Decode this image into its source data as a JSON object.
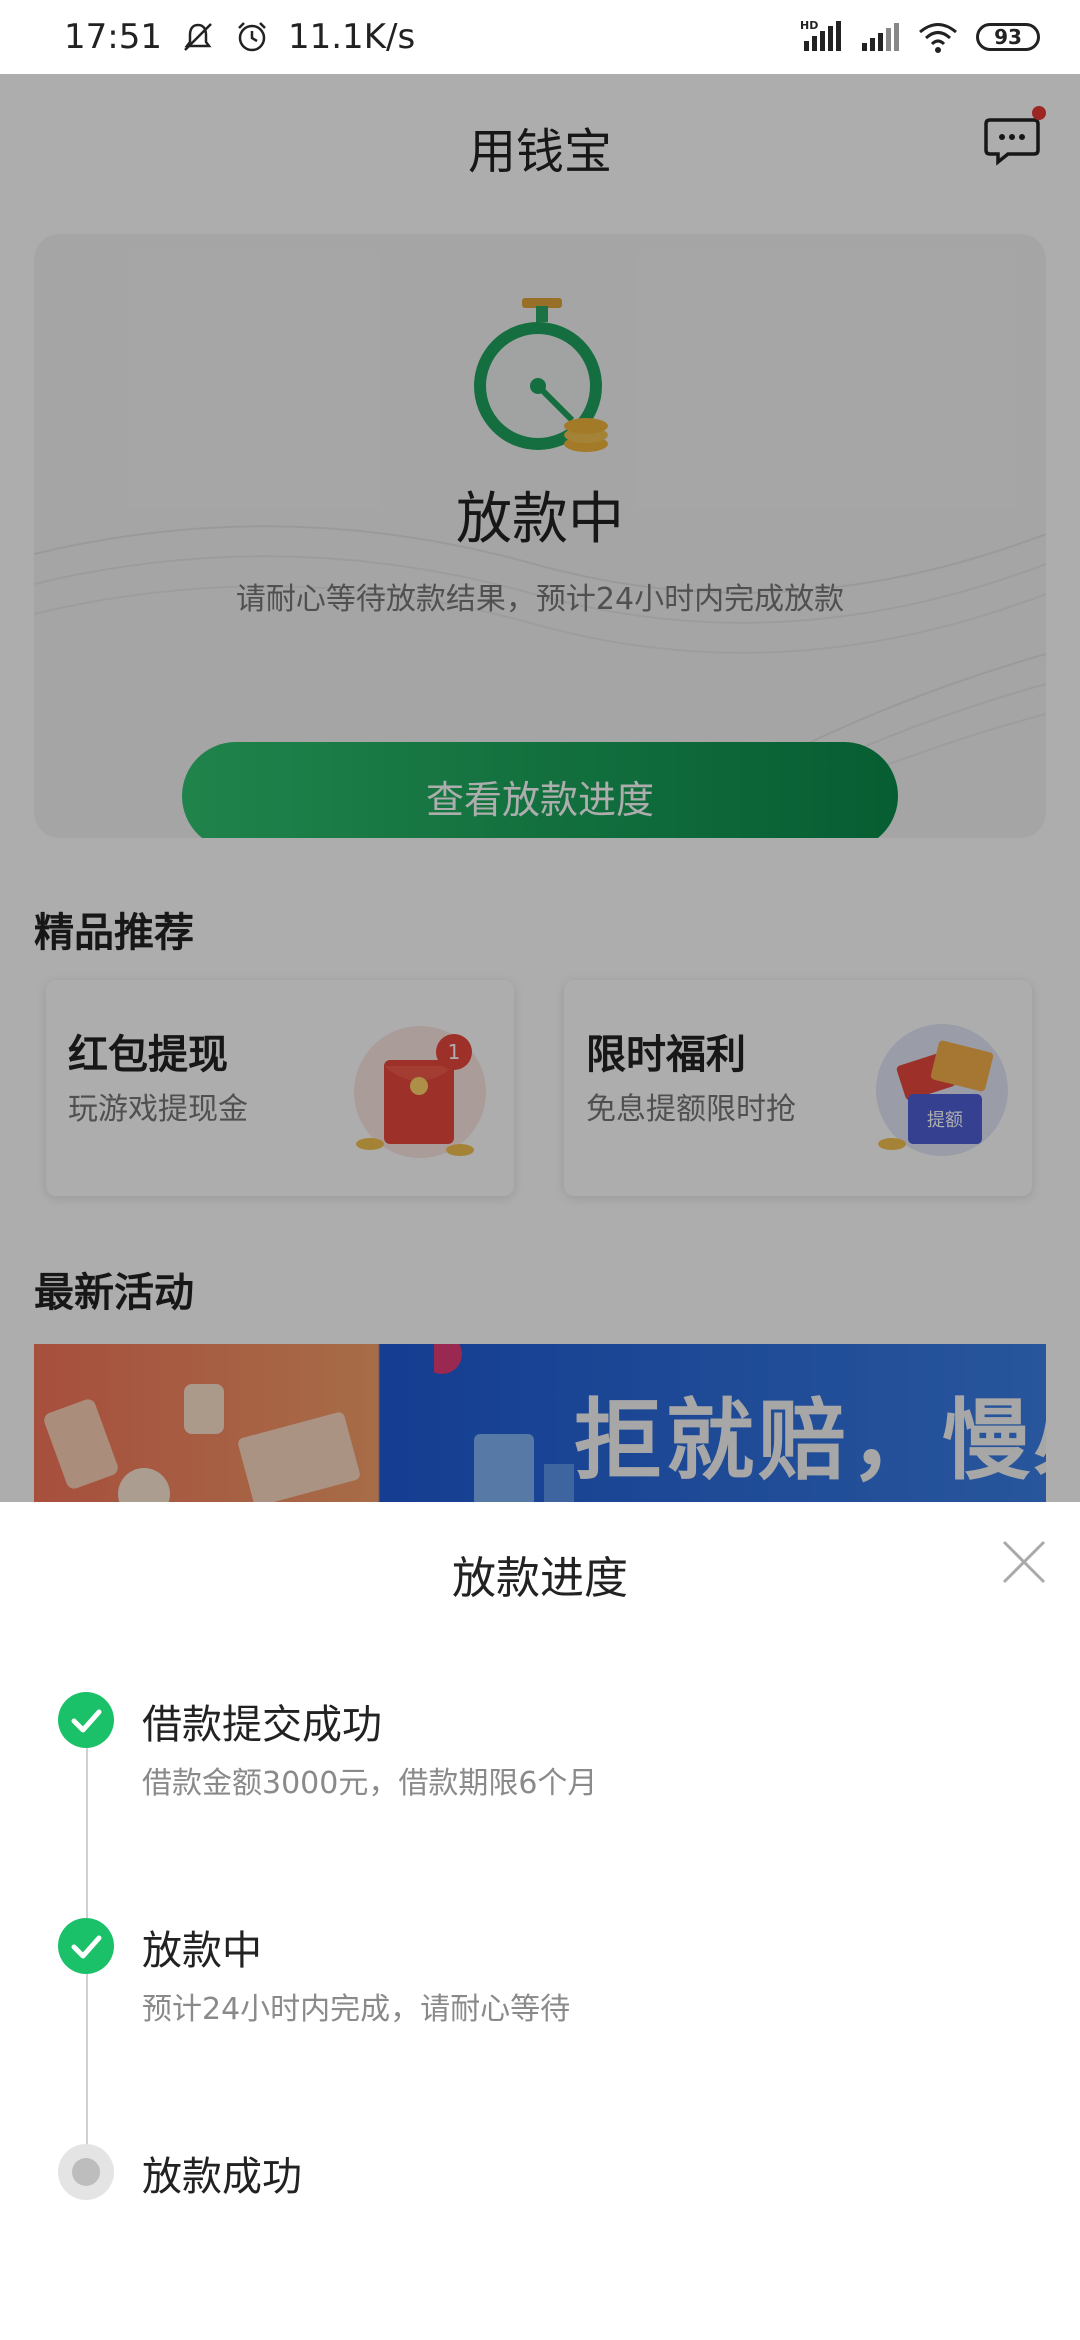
{
  "status_bar": {
    "time": "17:51",
    "net_speed": "11.1K/s",
    "battery": "93",
    "hd_label": "HD"
  },
  "header": {
    "title": "用钱宝"
  },
  "status_card": {
    "title": "放款中",
    "subtitle": "请耐心等待放款结果，预计24小时内完成放款",
    "button": "查看放款进度"
  },
  "recommend": {
    "title": "精品推荐",
    "cards": [
      {
        "title": "红包提现",
        "subtitle": "玩游戏提现金",
        "badge": "1"
      },
      {
        "title": "限时福利",
        "subtitle": "免息提额限时抢",
        "badge_text": "提额"
      }
    ]
  },
  "activities": {
    "title": "最新活动",
    "banner_text": "拒就赔，慢必"
  },
  "sheet": {
    "title": "放款进度",
    "steps": [
      {
        "title": "借款提交成功",
        "subtitle": "借款金额3000元，借款期限6个月",
        "state": "done"
      },
      {
        "title": "放款中",
        "subtitle": "预计24小时内完成，请耐心等待",
        "state": "done"
      },
      {
        "title": "放款成功",
        "subtitle": "",
        "state": "pending"
      }
    ]
  },
  "colors": {
    "accent": "#1bc168",
    "button_start": "#2fc26f",
    "button_end": "#0a8a4a"
  }
}
